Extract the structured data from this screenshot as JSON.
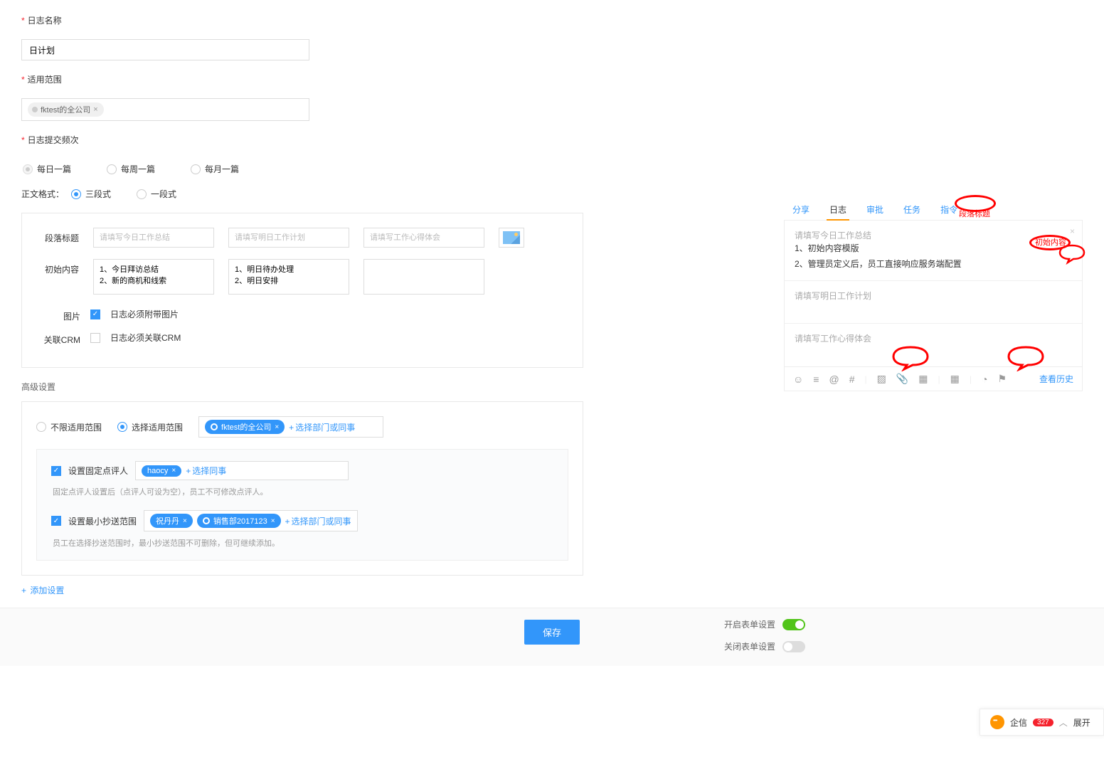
{
  "form": {
    "logName": {
      "label": "日志名称",
      "value": "日计划"
    },
    "scope": {
      "label": "适用范围",
      "tag": "fktest的全公司"
    },
    "frequency": {
      "label": "日志提交频次",
      "options": [
        "每日一篇",
        "每周一篇",
        "每月一篇"
      ],
      "selected": 0
    },
    "bodyFormat": {
      "label": "正文格式：",
      "options": [
        "三段式",
        "一段式"
      ],
      "selected": 0
    },
    "section": {
      "rowTitleLabel": "段落标题",
      "initContentLabel": "初始内容",
      "col1": {
        "titlePh": "请填写今日工作总结",
        "content": "1、今日拜访总结\n2、新的商机和线索"
      },
      "col2": {
        "titlePh": "请填写明日工作计划",
        "content": "1、明日待办处理\n2、明日安排"
      },
      "col3": {
        "titlePh": "请填写工作心得体会",
        "content": ""
      },
      "imageLabel": "图片",
      "imageCheck": "日志必须附带图片",
      "crmLabel": "关联CRM",
      "crmCheck": "日志必须关联CRM"
    },
    "advanced": {
      "title": "高级设置",
      "unlimited": "不限适用范围",
      "selectScope": "选择适用范围",
      "scopeTag": "fktest的全公司",
      "selectDept": "选择部门或同事",
      "fixedReviewer": "设置固定点评人",
      "reviewerTag": "haocy",
      "selectColleague": "选择同事",
      "reviewerHint": "固定点评人设置后（点评人可设为空），员工不可修改点评人。",
      "minCC": "设置最小抄送范围",
      "ccTag1": "祝丹丹",
      "ccTag2": "销售部2017123",
      "ccHint": "员工在选择抄送范围时，最小抄送范围不可删除，但可继续添加。"
    },
    "addSetting": "添加设置",
    "save": "保存",
    "toggleOn": "开启表单设置",
    "toggleOff": "关闭表单设置"
  },
  "preview": {
    "tabs": [
      "分享",
      "日志",
      "审批",
      "任务",
      "指令"
    ],
    "activeIndex": 1,
    "block1": {
      "placeholder": "请填写今日工作总结",
      "line1": "1、初始内容模版",
      "line2": "2、管理员定义后，员工直接响应服务端配置"
    },
    "block2": {
      "placeholder": "请填写明日工作计划"
    },
    "block3": {
      "placeholder": "请填写工作心得体会"
    },
    "history": "查看历史",
    "annoTitle": "段落标题",
    "annoInit": "初始内容"
  },
  "chat": {
    "label": "企信",
    "count": "327",
    "expand": "展开"
  }
}
